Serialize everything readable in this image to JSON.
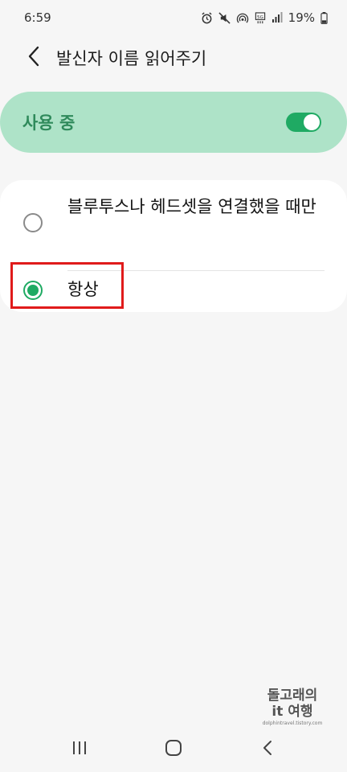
{
  "status_bar": {
    "time": "6:59",
    "battery": "19%",
    "icons": [
      "alarm-icon",
      "mute-icon",
      "hotspot-icon",
      "volte-icon",
      "signal-icon",
      "battery-icon"
    ]
  },
  "app_bar": {
    "title": "발신자 이름 읽어주기",
    "back_icon": "back-arrow-icon"
  },
  "master_switch": {
    "label": "사용 중",
    "state": "on",
    "accent_color": "#1faa63",
    "card_color": "#aee3c8"
  },
  "options": [
    {
      "label": "블루투스나 헤드셋을 연결했을 때만",
      "selected": false
    },
    {
      "label": "항상",
      "selected": true
    }
  ],
  "watermark": {
    "line1": "돌고래의",
    "line2": "it 여행",
    "line3": "dolphintravel.tistory.com"
  },
  "nav_bar": [
    "recent-apps-icon",
    "home-icon",
    "back-icon"
  ]
}
